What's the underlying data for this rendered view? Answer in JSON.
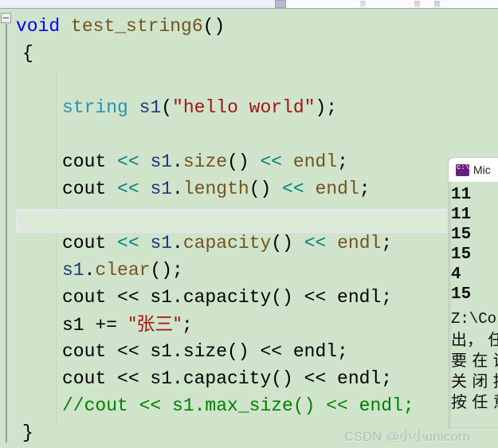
{
  "app": {
    "kind": "visual-studio-code-editor",
    "theme_background": "#cfe4cb",
    "current_line_background": "#dcead8",
    "current_line_border": "#e8e6f0"
  },
  "toolbar": {
    "hscrollbar_name": "horizontal-scrollbar",
    "ghost_icons": [
      "toolbar-icon-1",
      "toolbar-icon-2",
      "toolbar-icon-3"
    ]
  },
  "gutter": {
    "collapse_label": "-",
    "outlining_name": "outlining-collapse-toggle"
  },
  "colors": {
    "keyword": "#0000ff",
    "type": "#2b91af",
    "variable": "#1f377f",
    "member_function": "#74531f",
    "string_literal": "#a31515",
    "operator": "#008080",
    "comment": "#008000",
    "plain": "#000000"
  },
  "code": {
    "language": "C++",
    "lines": [
      {
        "n": 1,
        "indent": 0,
        "tokens": [
          {
            "t": "void",
            "c": "keyword"
          },
          {
            "t": " ",
            "c": "plain"
          },
          {
            "t": "test_string6",
            "c": "member_function"
          },
          {
            "t": "()",
            "c": "plain"
          }
        ]
      },
      {
        "n": 2,
        "indent": 1,
        "tokens": [
          {
            "t": "{",
            "c": "plain"
          }
        ]
      },
      {
        "n": 3,
        "indent": 1,
        "tokens": []
      },
      {
        "n": 4,
        "indent": 2,
        "tokens": [
          {
            "t": "string",
            "c": "type"
          },
          {
            "t": " ",
            "c": "plain"
          },
          {
            "t": "s1",
            "c": "variable"
          },
          {
            "t": "(",
            "c": "plain"
          },
          {
            "t": "\"hello world\"",
            "c": "string_literal"
          },
          {
            "t": ");",
            "c": "plain"
          }
        ]
      },
      {
        "n": 5,
        "indent": 2,
        "tokens": []
      },
      {
        "n": 6,
        "indent": 2,
        "tokens": [
          {
            "t": "cout ",
            "c": "plain"
          },
          {
            "t": "<<",
            "c": "operator"
          },
          {
            "t": " ",
            "c": "plain"
          },
          {
            "t": "s1",
            "c": "variable"
          },
          {
            "t": ".",
            "c": "plain"
          },
          {
            "t": "size",
            "c": "member_function"
          },
          {
            "t": "() ",
            "c": "plain"
          },
          {
            "t": "<<",
            "c": "operator"
          },
          {
            "t": " ",
            "c": "plain"
          },
          {
            "t": "endl",
            "c": "member_function"
          },
          {
            "t": ";",
            "c": "plain"
          }
        ]
      },
      {
        "n": 7,
        "indent": 2,
        "tokens": [
          {
            "t": "cout ",
            "c": "plain"
          },
          {
            "t": "<<",
            "c": "operator"
          },
          {
            "t": " ",
            "c": "plain"
          },
          {
            "t": "s1",
            "c": "variable"
          },
          {
            "t": ".",
            "c": "plain"
          },
          {
            "t": "length",
            "c": "member_function"
          },
          {
            "t": "() ",
            "c": "plain"
          },
          {
            "t": "<<",
            "c": "operator"
          },
          {
            "t": " ",
            "c": "plain"
          },
          {
            "t": "endl",
            "c": "member_function"
          },
          {
            "t": ";",
            "c": "plain"
          }
        ]
      },
      {
        "n": 8,
        "indent": 2,
        "current": true,
        "tokens": []
      },
      {
        "n": 9,
        "indent": 2,
        "tokens": [
          {
            "t": "cout ",
            "c": "plain"
          },
          {
            "t": "<<",
            "c": "operator"
          },
          {
            "t": " ",
            "c": "plain"
          },
          {
            "t": "s1",
            "c": "variable"
          },
          {
            "t": ".",
            "c": "plain"
          },
          {
            "t": "capacity",
            "c": "member_function"
          },
          {
            "t": "() ",
            "c": "plain"
          },
          {
            "t": "<<",
            "c": "operator"
          },
          {
            "t": " ",
            "c": "plain"
          },
          {
            "t": "endl",
            "c": "member_function"
          },
          {
            "t": ";",
            "c": "plain"
          }
        ]
      },
      {
        "n": 10,
        "indent": 2,
        "tokens": [
          {
            "t": "s1",
            "c": "variable"
          },
          {
            "t": ".",
            "c": "plain"
          },
          {
            "t": "clear",
            "c": "member_function"
          },
          {
            "t": "();",
            "c": "plain"
          }
        ]
      },
      {
        "n": 11,
        "indent": 2,
        "tokens": [
          {
            "t": "cout << s1.capacity() << endl;",
            "c": "plain"
          }
        ]
      },
      {
        "n": 12,
        "indent": 2,
        "tokens": [
          {
            "t": "s1 += ",
            "c": "plain"
          },
          {
            "t": "\"张三\"",
            "c": "string_literal",
            "cjk": true
          },
          {
            "t": ";",
            "c": "plain"
          }
        ]
      },
      {
        "n": 13,
        "indent": 2,
        "tokens": [
          {
            "t": "cout << s1.size() << endl;",
            "c": "plain"
          }
        ]
      },
      {
        "n": 14,
        "indent": 2,
        "tokens": [
          {
            "t": "cout << s1.capacity() << endl;",
            "c": "plain"
          }
        ]
      },
      {
        "n": 15,
        "indent": 2,
        "tokens": [
          {
            "t": "//cout << s1.max_size() << endl;",
            "c": "comment"
          }
        ]
      },
      {
        "n": 16,
        "indent": 1,
        "tokens": [
          {
            "t": "}",
            "c": "plain"
          }
        ]
      }
    ]
  },
  "console": {
    "icon": "command-prompt-icon",
    "title": "Mic",
    "title_full": "Microsoft Visual Studio Debug Console",
    "output_values": [
      "11",
      "11",
      "15",
      "15",
      "4",
      "15"
    ],
    "path_line": "Z:\\Co",
    "message_lines": [
      "出， 任",
      "要 在 调",
      "关 闭 按",
      "按 任 意"
    ]
  },
  "watermark": {
    "text": "CSDN @小小unicorn"
  }
}
